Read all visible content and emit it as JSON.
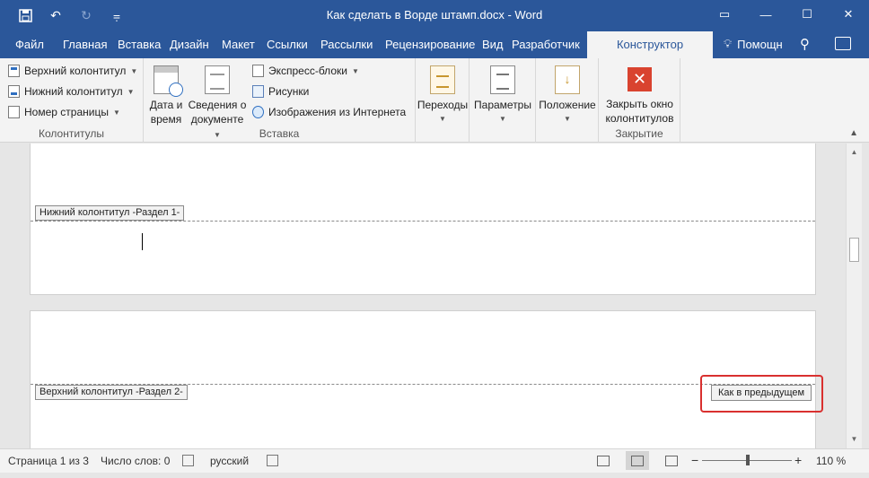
{
  "window": {
    "title": "Как сделать в Ворде штамп.docx - Word",
    "qat": {
      "save_icon": "save-icon",
      "undo_icon": "undo-icon",
      "redo_icon": "redo-icon",
      "customize_icon": "customize-icon"
    },
    "controls": {
      "ribbon_display": "▭",
      "minimize": "—",
      "maximize": "☐",
      "close": "✕"
    }
  },
  "tabs": [
    "Файл",
    "Главная",
    "Вставка",
    "Дизайн",
    "Макет",
    "Ссылки",
    "Рассылки",
    "Рецензирование",
    "Вид",
    "Разработчик",
    "Конструктор"
  ],
  "active_tab": "Конструктор",
  "help": {
    "label": "Помощн"
  },
  "ribbon": {
    "kolontituly": {
      "label": "Колонтитулы",
      "items": [
        "Верхний колонтитул",
        "Нижний колонтитул",
        "Номер страницы"
      ]
    },
    "vstavka": {
      "label": "Вставка",
      "date_line1": "Дата и",
      "date_line2": "время",
      "docinfo_line1": "Сведения о",
      "docinfo_line2": "документе",
      "small_items": [
        "Экспресс-блоки",
        "Рисунки",
        "Изображения из Интернета"
      ]
    },
    "navigation": {
      "label": "Переходы"
    },
    "options": {
      "label": "Параметры"
    },
    "position": {
      "label": "Положение"
    },
    "close": {
      "label": "Закрытие",
      "btn_line1": "Закрыть окно",
      "btn_line2": "колонтитулов"
    }
  },
  "document": {
    "footer_label": "Нижний колонтитул -Раздел 1-",
    "header_label": "Верхний колонтитул -Раздел 2-",
    "same_as_previous": "Как в предыдущем"
  },
  "statusbar": {
    "page": "Страница 1 из 3",
    "words": "Число слов: 0",
    "language": "русский",
    "zoom": "110 %",
    "zoom_minus": "−",
    "zoom_plus": "+"
  },
  "colors": {
    "accent": "#2b579a",
    "highlight": "#d9302f",
    "close_btn": "#d9432f"
  }
}
